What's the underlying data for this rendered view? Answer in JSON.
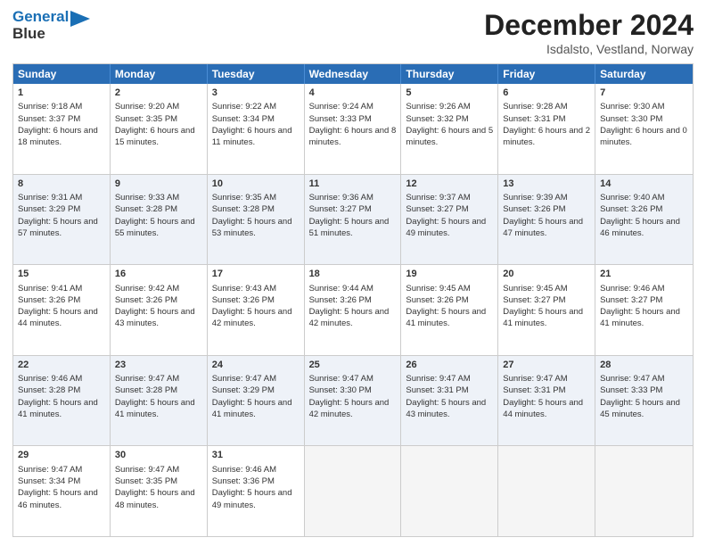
{
  "logo": {
    "line1": "General",
    "line2": "Blue"
  },
  "title": "December 2024",
  "location": "Isdalsto, Vestland, Norway",
  "days": [
    "Sunday",
    "Monday",
    "Tuesday",
    "Wednesday",
    "Thursday",
    "Friday",
    "Saturday"
  ],
  "weeks": [
    [
      {
        "day": "1",
        "sunrise": "9:18 AM",
        "sunset": "3:37 PM",
        "daylight": "6 hours and 18 minutes."
      },
      {
        "day": "2",
        "sunrise": "9:20 AM",
        "sunset": "3:35 PM",
        "daylight": "6 hours and 15 minutes."
      },
      {
        "day": "3",
        "sunrise": "9:22 AM",
        "sunset": "3:34 PM",
        "daylight": "6 hours and 11 minutes."
      },
      {
        "day": "4",
        "sunrise": "9:24 AM",
        "sunset": "3:33 PM",
        "daylight": "6 hours and 8 minutes."
      },
      {
        "day": "5",
        "sunrise": "9:26 AM",
        "sunset": "3:32 PM",
        "daylight": "6 hours and 5 minutes."
      },
      {
        "day": "6",
        "sunrise": "9:28 AM",
        "sunset": "3:31 PM",
        "daylight": "6 hours and 2 minutes."
      },
      {
        "day": "7",
        "sunrise": "9:30 AM",
        "sunset": "3:30 PM",
        "daylight": "6 hours and 0 minutes."
      }
    ],
    [
      {
        "day": "8",
        "sunrise": "9:31 AM",
        "sunset": "3:29 PM",
        "daylight": "5 hours and 57 minutes."
      },
      {
        "day": "9",
        "sunrise": "9:33 AM",
        "sunset": "3:28 PM",
        "daylight": "5 hours and 55 minutes."
      },
      {
        "day": "10",
        "sunrise": "9:35 AM",
        "sunset": "3:28 PM",
        "daylight": "5 hours and 53 minutes."
      },
      {
        "day": "11",
        "sunrise": "9:36 AM",
        "sunset": "3:27 PM",
        "daylight": "5 hours and 51 minutes."
      },
      {
        "day": "12",
        "sunrise": "9:37 AM",
        "sunset": "3:27 PM",
        "daylight": "5 hours and 49 minutes."
      },
      {
        "day": "13",
        "sunrise": "9:39 AM",
        "sunset": "3:26 PM",
        "daylight": "5 hours and 47 minutes."
      },
      {
        "day": "14",
        "sunrise": "9:40 AM",
        "sunset": "3:26 PM",
        "daylight": "5 hours and 46 minutes."
      }
    ],
    [
      {
        "day": "15",
        "sunrise": "9:41 AM",
        "sunset": "3:26 PM",
        "daylight": "5 hours and 44 minutes."
      },
      {
        "day": "16",
        "sunrise": "9:42 AM",
        "sunset": "3:26 PM",
        "daylight": "5 hours and 43 minutes."
      },
      {
        "day": "17",
        "sunrise": "9:43 AM",
        "sunset": "3:26 PM",
        "daylight": "5 hours and 42 minutes."
      },
      {
        "day": "18",
        "sunrise": "9:44 AM",
        "sunset": "3:26 PM",
        "daylight": "5 hours and 42 minutes."
      },
      {
        "day": "19",
        "sunrise": "9:45 AM",
        "sunset": "3:26 PM",
        "daylight": "5 hours and 41 minutes."
      },
      {
        "day": "20",
        "sunrise": "9:45 AM",
        "sunset": "3:27 PM",
        "daylight": "5 hours and 41 minutes."
      },
      {
        "day": "21",
        "sunrise": "9:46 AM",
        "sunset": "3:27 PM",
        "daylight": "5 hours and 41 minutes."
      }
    ],
    [
      {
        "day": "22",
        "sunrise": "9:46 AM",
        "sunset": "3:28 PM",
        "daylight": "5 hours and 41 minutes."
      },
      {
        "day": "23",
        "sunrise": "9:47 AM",
        "sunset": "3:28 PM",
        "daylight": "5 hours and 41 minutes."
      },
      {
        "day": "24",
        "sunrise": "9:47 AM",
        "sunset": "3:29 PM",
        "daylight": "5 hours and 41 minutes."
      },
      {
        "day": "25",
        "sunrise": "9:47 AM",
        "sunset": "3:30 PM",
        "daylight": "5 hours and 42 minutes."
      },
      {
        "day": "26",
        "sunrise": "9:47 AM",
        "sunset": "3:31 PM",
        "daylight": "5 hours and 43 minutes."
      },
      {
        "day": "27",
        "sunrise": "9:47 AM",
        "sunset": "3:31 PM",
        "daylight": "5 hours and 44 minutes."
      },
      {
        "day": "28",
        "sunrise": "9:47 AM",
        "sunset": "3:33 PM",
        "daylight": "5 hours and 45 minutes."
      }
    ],
    [
      {
        "day": "29",
        "sunrise": "9:47 AM",
        "sunset": "3:34 PM",
        "daylight": "5 hours and 46 minutes."
      },
      {
        "day": "30",
        "sunrise": "9:47 AM",
        "sunset": "3:35 PM",
        "daylight": "5 hours and 48 minutes."
      },
      {
        "day": "31",
        "sunrise": "9:46 AM",
        "sunset": "3:36 PM",
        "daylight": "5 hours and 49 minutes."
      },
      null,
      null,
      null,
      null
    ]
  ]
}
